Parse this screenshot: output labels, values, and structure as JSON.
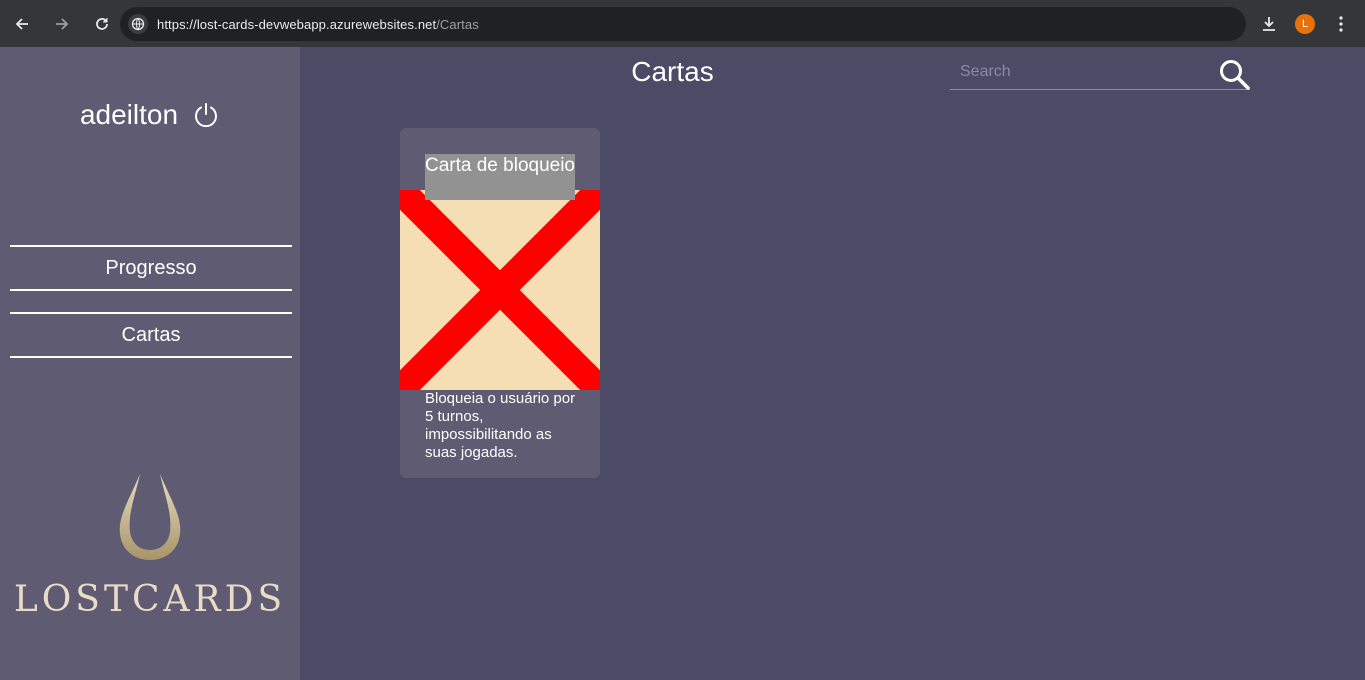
{
  "browser": {
    "url_host": "https://lost-cards-devwebapp.azurewebsites.net",
    "url_path": "/Cartas",
    "profile_initial": "L",
    "icons": [
      "back-arrow-icon",
      "forward-arrow-icon",
      "reload-icon",
      "site-info-icon",
      "download-icon",
      "kebab-menu-icon"
    ]
  },
  "sidebar": {
    "username": "adeilton",
    "nav": [
      {
        "label": "Progresso"
      },
      {
        "label": "Cartas"
      }
    ],
    "logo_text": "LOSTCARDS"
  },
  "main": {
    "title": "Cartas",
    "search": {
      "placeholder": "Search",
      "value": ""
    }
  },
  "cards": [
    {
      "title": "Carta de bloqueio",
      "description": "Bloqueia o usuário por 5 turnos, impossibilitando as suas jogadas."
    }
  ],
  "colors": {
    "main_bg": "#4c4a64",
    "sidebar_bg": "#5e5b73",
    "card_art_bg": "#f5deb3",
    "card_art_x": "#ff0000"
  }
}
